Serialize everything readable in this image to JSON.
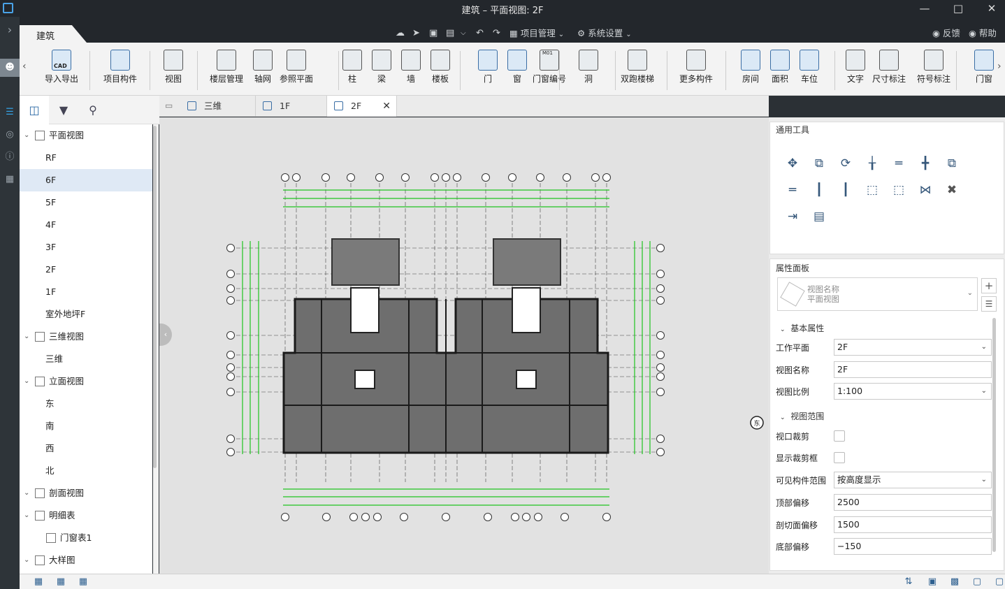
{
  "window": {
    "title": "建筑 – 平面视图: 2F"
  },
  "menubar": {
    "main_tab": "建筑",
    "project_manage": "项目管理",
    "system_settings": "系统设置",
    "feedback": "反馈",
    "help": "帮助"
  },
  "ribbon": {
    "items": [
      "导入导出",
      "项目构件",
      "视图",
      "楼层管理",
      "轴网",
      "参照平面",
      "柱",
      "梁",
      "墙",
      "楼板",
      "门",
      "窗",
      "门窗编号",
      "洞",
      "双跑楼梯",
      "更多构件",
      "房间",
      "面积",
      "车位",
      "文字",
      "尺寸标注",
      "符号标注",
      "门窗"
    ],
    "cad_badge": "CAD",
    "door_window_badge": "M01"
  },
  "tree": {
    "nodes": [
      {
        "label": "平面视图",
        "level": 0
      },
      {
        "label": "RF",
        "level": 1
      },
      {
        "label": "6F",
        "level": 1,
        "selected": true
      },
      {
        "label": "5F",
        "level": 1
      },
      {
        "label": "4F",
        "level": 1
      },
      {
        "label": "3F",
        "level": 1
      },
      {
        "label": "2F",
        "level": 1
      },
      {
        "label": "1F",
        "level": 1
      },
      {
        "label": "室外地坪F",
        "level": 1
      },
      {
        "label": "三维视图",
        "level": 0
      },
      {
        "label": "三维",
        "level": 1
      },
      {
        "label": "立面视图",
        "level": 0
      },
      {
        "label": "东",
        "level": 1
      },
      {
        "label": "南",
        "level": 1
      },
      {
        "label": "西",
        "level": 1
      },
      {
        "label": "北",
        "level": 1
      },
      {
        "label": "剖面视图",
        "level": 0
      },
      {
        "label": "明细表",
        "level": 0
      },
      {
        "label": "门窗表1",
        "level": 1
      },
      {
        "label": "大样图",
        "level": 0
      }
    ]
  },
  "doc_tabs": [
    {
      "label": "三维"
    },
    {
      "label": "1F"
    },
    {
      "label": "2F",
      "active": true
    }
  ],
  "canvas": {
    "compass_label": "东"
  },
  "general_tools": {
    "title": "通用工具"
  },
  "properties": {
    "title": "属性面板",
    "type_selector": {
      "line1": "视图名称",
      "line2": "平面视图"
    },
    "basic_section": "基本属性",
    "work_plane": {
      "label": "工作平面",
      "value": "2F"
    },
    "view_name": {
      "label": "视图名称",
      "value": "2F"
    },
    "view_scale": {
      "label": "视图比例",
      "value": "1:100"
    },
    "range_section": "视图范围",
    "viewport_crop": {
      "label": "视口裁剪",
      "checked": false
    },
    "show_crop": {
      "label": "显示裁剪框",
      "checked": false
    },
    "visible_range": {
      "label": "可见构件范围",
      "value": "按高度显示"
    },
    "top_offset": {
      "label": "顶部偏移",
      "value": "2500"
    },
    "cut_offset": {
      "label": "剖切面偏移",
      "value": "1500"
    },
    "bottom_offset": {
      "label": "底部偏移",
      "value": "−150"
    }
  }
}
